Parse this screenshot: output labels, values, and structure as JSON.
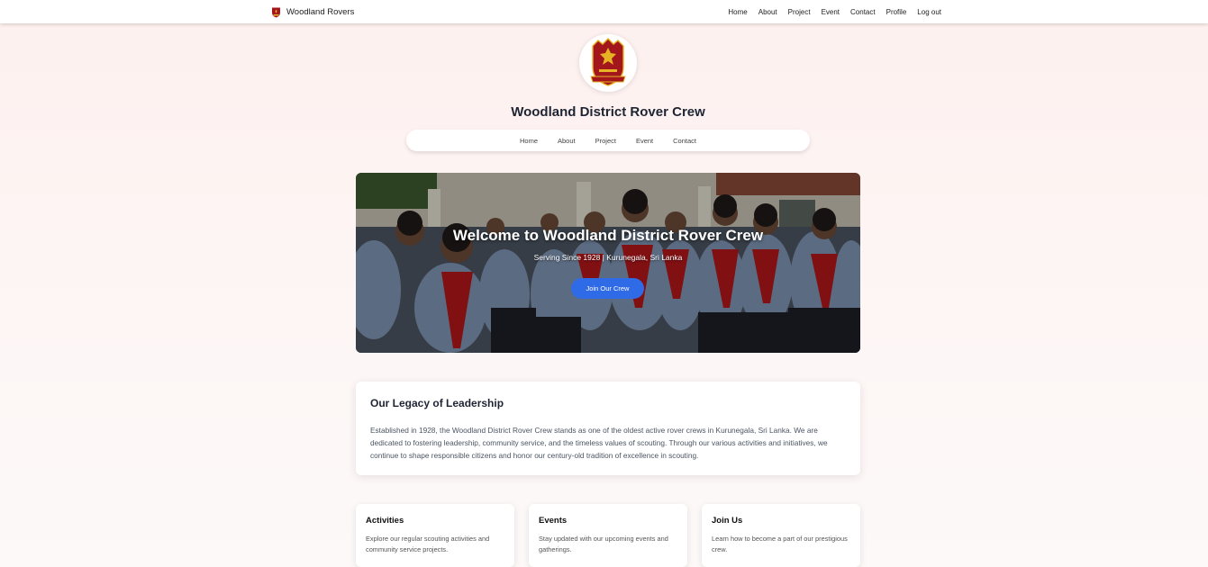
{
  "topbar": {
    "brand": "Woodland Rovers",
    "links": [
      "Home",
      "About",
      "Project",
      "Event",
      "Contact",
      "Profile",
      "Log out"
    ]
  },
  "header": {
    "title": "Woodland District Rover Crew",
    "nav": [
      "Home",
      "About",
      "Project",
      "Event",
      "Contact"
    ]
  },
  "hero": {
    "title": "Welcome to Woodland District Rover Crew",
    "subtitle": "Serving Since 1928 | Kurunegala, Sri Lanka",
    "button": "Join Our Crew"
  },
  "legacy": {
    "title": "Our Legacy of Leadership",
    "body": "Established in 1928, the Woodland District Rover Crew stands as one of the oldest active rover crews in Kurunegala, Sri Lanka. We are dedicated to fostering leadership, community service, and the timeless values of scouting. Through our various activities and initiatives, we continue to shape responsible citizens and honor our century-old tradition of excellence in scouting."
  },
  "cards": [
    {
      "title": "Activities",
      "text": "Explore our regular scouting activities and community service projects."
    },
    {
      "title": "Events",
      "text": "Stay updated with our upcoming events and gatherings."
    },
    {
      "title": "Join Us",
      "text": "Learn how to become a part of our prestigious crew."
    }
  ],
  "colors": {
    "accent": "#2f6be6",
    "emblem_red": "#a3161b",
    "emblem_gold": "#e6b325"
  },
  "icons": {
    "brand": "crest-icon"
  }
}
